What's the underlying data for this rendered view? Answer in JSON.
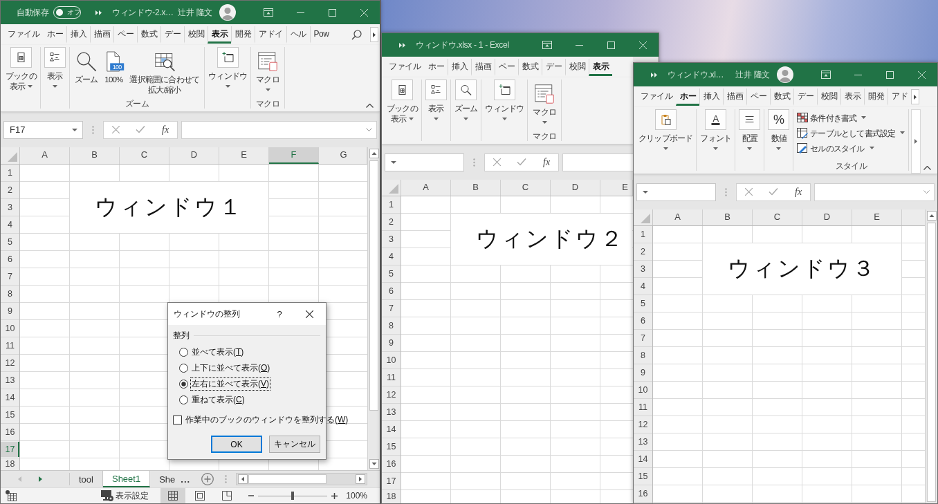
{
  "windows": [
    {
      "title_bar": {
        "autosave": {
          "label": "自動保存",
          "state": "オフ",
          "on": false
        },
        "title": "ウィンドウ-2.x…",
        "user": "辻井 隆文"
      },
      "tabs": [
        {
          "label": "ファイル",
          "selected": false
        },
        {
          "label": "ホー",
          "selected": false
        },
        {
          "label": "挿入",
          "selected": false
        },
        {
          "label": "描画",
          "selected": false
        },
        {
          "label": "ペー",
          "selected": false
        },
        {
          "label": "数式",
          "selected": false
        },
        {
          "label": "デー",
          "selected": false
        },
        {
          "label": "校閲",
          "selected": false
        },
        {
          "label": "表示",
          "selected": true
        },
        {
          "label": "開発",
          "selected": false
        },
        {
          "label": "アドイ",
          "selected": false
        },
        {
          "label": "ヘル",
          "selected": false
        },
        {
          "label": "Pow",
          "selected": false
        }
      ],
      "ribbon": {
        "groups": [
          {
            "kind": "collapsed",
            "items": [
              {
                "kind": "bookview",
                "lines": [
                  "ブックの",
                  "表示"
                ],
                "dropdown": true
              }
            ]
          },
          {
            "kind": "collapsed",
            "items": [
              {
                "kind": "show",
                "lines": [
                  "表示"
                ],
                "dropdown": true
              }
            ]
          },
          {
            "kind": "large",
            "label": "ズーム",
            "items": [
              {
                "kind": "zoom",
                "lines": [
                  "ズーム"
                ],
                "dropdown": false
              },
              {
                "kind": "hundred",
                "badge": "100",
                "lines": [
                  "100%"
                ],
                "dropdown": false
              },
              {
                "kind": "fitzoom",
                "lines": [
                  "選択範囲に合わせて",
                  "拡大/縮小"
                ],
                "dropdown": false
              }
            ]
          },
          {
            "kind": "collapsed",
            "items": [
              {
                "kind": "window",
                "lines": [
                  "ウィンドウ"
                ],
                "dropdown": true
              }
            ]
          },
          {
            "kind": "large",
            "label": "マクロ",
            "items": [
              {
                "kind": "macro",
                "lines": [
                  "マクロ"
                ],
                "dropdown": true
              }
            ]
          }
        ]
      },
      "formula_bar": {
        "name_box": "F17",
        "function_button": "fx"
      },
      "sheet": {
        "columns": [
          {
            "label": "A",
            "selected": false
          },
          {
            "label": "B",
            "selected": false
          },
          {
            "label": "C",
            "selected": false
          },
          {
            "label": "D",
            "selected": false
          },
          {
            "label": "E",
            "selected": false
          },
          {
            "label": "F",
            "selected": true
          },
          {
            "label": "G",
            "selected": false
          }
        ],
        "rows": [
          {
            "label": "1",
            "selected": false
          },
          {
            "label": "2",
            "selected": false
          },
          {
            "label": "3",
            "selected": false
          },
          {
            "label": "4",
            "selected": false
          },
          {
            "label": "5",
            "selected": false
          },
          {
            "label": "6",
            "selected": false
          },
          {
            "label": "7",
            "selected": false
          },
          {
            "label": "8",
            "selected": false
          },
          {
            "label": "9",
            "selected": false
          },
          {
            "label": "10",
            "selected": false
          },
          {
            "label": "11",
            "selected": false
          },
          {
            "label": "12",
            "selected": false
          },
          {
            "label": "13",
            "selected": false
          },
          {
            "label": "14",
            "selected": false
          },
          {
            "label": "15",
            "selected": false
          },
          {
            "label": "16",
            "selected": false
          },
          {
            "label": "17",
            "selected": true
          },
          {
            "label": "18",
            "selected": false
          }
        ],
        "merged_cell": "ウィンドウ１"
      },
      "sheet_tabs": {
        "tabs": [
          {
            "label": "tool",
            "selected": false
          },
          {
            "label": "Sheet1",
            "selected": true
          },
          {
            "label": "She",
            "selected": false
          }
        ],
        "more": "..."
      },
      "status_bar": {
        "display_settings": "表示設定",
        "views": [
          {
            "kind": "normal",
            "selected": true
          },
          {
            "kind": "layout",
            "selected": false
          },
          {
            "kind": "pagebreak",
            "selected": false
          }
        ],
        "zoom": {
          "level": 0.5,
          "reading": "100%"
        }
      }
    },
    {
      "title_bar": {
        "title": "ウィンドウ.xlsx - 1 - Excel"
      },
      "tabs": [
        {
          "label": "ファイル",
          "selected": false
        },
        {
          "label": "ホー",
          "selected": false
        },
        {
          "label": "挿入",
          "selected": false
        },
        {
          "label": "描画",
          "selected": false
        },
        {
          "label": "ペー",
          "selected": false
        },
        {
          "label": "数式",
          "selected": false
        },
        {
          "label": "デー",
          "selected": false
        },
        {
          "label": "校閲",
          "selected": false
        },
        {
          "label": "表示",
          "selected": true
        }
      ],
      "ribbon": {
        "groups": [
          {
            "kind": "collapsed",
            "items": [
              {
                "kind": "bookview",
                "lines": [
                  "ブックの",
                  "表示"
                ],
                "dropdown": true
              }
            ]
          },
          {
            "kind": "collapsed",
            "items": [
              {
                "kind": "show",
                "lines": [
                  "表示"
                ],
                "dropdown": true
              }
            ]
          },
          {
            "kind": "collapsed",
            "items": [
              {
                "kind": "zoom",
                "lines": [
                  "ズーム"
                ],
                "dropdown": true
              }
            ]
          },
          {
            "kind": "collapsed",
            "items": [
              {
                "kind": "window",
                "lines": [
                  "ウィンドウ"
                ],
                "dropdown": true
              }
            ]
          },
          {
            "kind": "large",
            "label": "マクロ",
            "items": [
              {
                "kind": "macro",
                "lines": [
                  "マクロ"
                ],
                "dropdown": true
              }
            ]
          }
        ]
      },
      "formula_bar": {
        "function_button": "fx"
      },
      "sheet": {
        "columns": [
          {
            "label": "A",
            "selected": false
          },
          {
            "label": "B",
            "selected": false
          },
          {
            "label": "C",
            "selected": false
          },
          {
            "label": "D",
            "selected": false
          },
          {
            "label": "E",
            "selected": false
          }
        ],
        "rows": [
          {
            "label": "1",
            "selected": false
          },
          {
            "label": "2",
            "selected": false
          },
          {
            "label": "3",
            "selected": false
          },
          {
            "label": "4",
            "selected": false
          },
          {
            "label": "5",
            "selected": false
          },
          {
            "label": "6",
            "selected": false
          },
          {
            "label": "7",
            "selected": false
          },
          {
            "label": "8",
            "selected": false
          },
          {
            "label": "9",
            "selected": false
          },
          {
            "label": "10",
            "selected": false
          },
          {
            "label": "11",
            "selected": false
          },
          {
            "label": "12",
            "selected": false
          },
          {
            "label": "13",
            "selected": false
          },
          {
            "label": "14",
            "selected": false
          },
          {
            "label": "15",
            "selected": false
          },
          {
            "label": "16",
            "selected": false
          },
          {
            "label": "17",
            "selected": false
          },
          {
            "label": "18",
            "selected": false
          }
        ],
        "merged_cell": "ウィンドウ２"
      }
    },
    {
      "title_bar": {
        "title": "ウィンドウ.xl…",
        "user": "辻井 隆文"
      },
      "tabs": [
        {
          "label": "ファイル",
          "selected": false
        },
        {
          "label": "ホー",
          "selected": true
        },
        {
          "label": "挿入",
          "selected": false
        },
        {
          "label": "描画",
          "selected": false
        },
        {
          "label": "ペー",
          "selected": false
        },
        {
          "label": "数式",
          "selected": false
        },
        {
          "label": "デー",
          "selected": false
        },
        {
          "label": "校閲",
          "selected": false
        },
        {
          "label": "表示",
          "selected": false
        },
        {
          "label": "開発",
          "selected": false
        },
        {
          "label": "アド",
          "selected": false
        }
      ],
      "ribbon": {
        "groups": [
          {
            "kind": "collapsed",
            "items": [
              {
                "kind": "clipboard",
                "lines": [
                  "クリップボード"
                ],
                "dropdown": true
              }
            ]
          },
          {
            "kind": "collapsed",
            "items": [
              {
                "kind": "font",
                "badge": "A",
                "lines": [
                  "フォント"
                ],
                "dropdown": true
              }
            ]
          },
          {
            "kind": "collapsed",
            "items": [
              {
                "kind": "align",
                "lines": [
                  "配置"
                ],
                "dropdown": true
              }
            ]
          },
          {
            "kind": "collapsed",
            "items": [
              {
                "kind": "number",
                "badge": "%",
                "lines": [
                  "数値"
                ],
                "dropdown": true
              }
            ]
          },
          {
            "kind": "stacked",
            "label": "スタイル",
            "items": [
              {
                "kind": "condformat",
                "lines": [
                  "条件付き書式"
                ],
                "dropdown": true
              },
              {
                "kind": "tableformat",
                "lines": [
                  "テーブルとして書式設定"
                ],
                "dropdown": true
              },
              {
                "kind": "cellstyle",
                "lines": [
                  "セルのスタイル"
                ],
                "dropdown": true
              }
            ]
          }
        ]
      },
      "formula_bar": {
        "function_button": "fx"
      },
      "sheet": {
        "columns": [
          {
            "label": "A",
            "selected": false
          },
          {
            "label": "B",
            "selected": false
          },
          {
            "label": "C",
            "selected": false
          },
          {
            "label": "D",
            "selected": false
          },
          {
            "label": "E",
            "selected": false
          }
        ],
        "rows": [
          {
            "label": "1",
            "selected": false
          },
          {
            "label": "2",
            "selected": false
          },
          {
            "label": "3",
            "selected": false
          },
          {
            "label": "4",
            "selected": false
          },
          {
            "label": "5",
            "selected": false
          },
          {
            "label": "6",
            "selected": false
          },
          {
            "label": "7",
            "selected": false
          },
          {
            "label": "8",
            "selected": false
          },
          {
            "label": "9",
            "selected": false
          },
          {
            "label": "10",
            "selected": false
          },
          {
            "label": "11",
            "selected": false
          },
          {
            "label": "12",
            "selected": false
          },
          {
            "label": "13",
            "selected": false
          },
          {
            "label": "14",
            "selected": false
          },
          {
            "label": "15",
            "selected": false
          },
          {
            "label": "16",
            "selected": false
          }
        ],
        "merged_cell": "ウィンドウ３"
      }
    }
  ],
  "dialog": {
    "title": "ウィンドウの整列",
    "help": "?",
    "group_label": "整列",
    "options": [
      {
        "label": "並べて表示(T)",
        "selected": false
      },
      {
        "label": "上下に並べて表示(O)",
        "selected": false
      },
      {
        "label": "左右に並べて表示(V)",
        "selected": true
      },
      {
        "label": "重ねて表示(C)",
        "selected": false
      }
    ],
    "checkbox": {
      "label": "作業中のブックのウィンドウを整列する(W)",
      "checked": false
    },
    "buttons": [
      {
        "label": "OK",
        "default": true
      },
      {
        "label": "キャンセル",
        "default": false
      }
    ]
  }
}
